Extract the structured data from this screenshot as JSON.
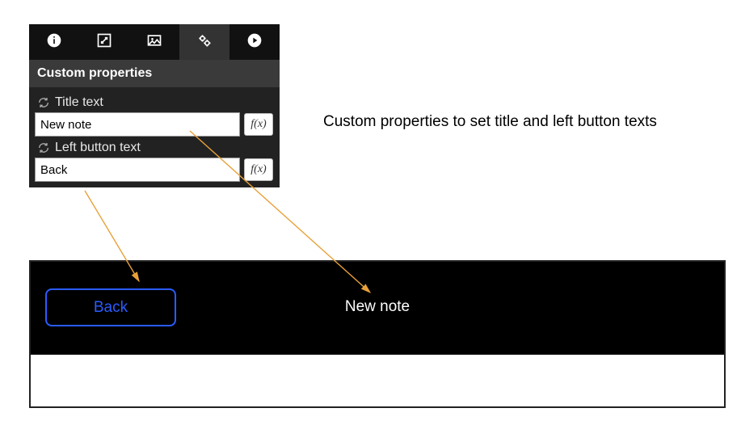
{
  "panel": {
    "section_header": "Custom properties",
    "props": {
      "title": {
        "label": "Title text",
        "value": "New note",
        "fx": "f(x)"
      },
      "left_button": {
        "label": "Left button text",
        "value": "Back",
        "fx": "f(x)"
      }
    }
  },
  "annotation": "Custom properties to set title and left button texts",
  "preview": {
    "back_label": "Back",
    "title": "New note"
  }
}
